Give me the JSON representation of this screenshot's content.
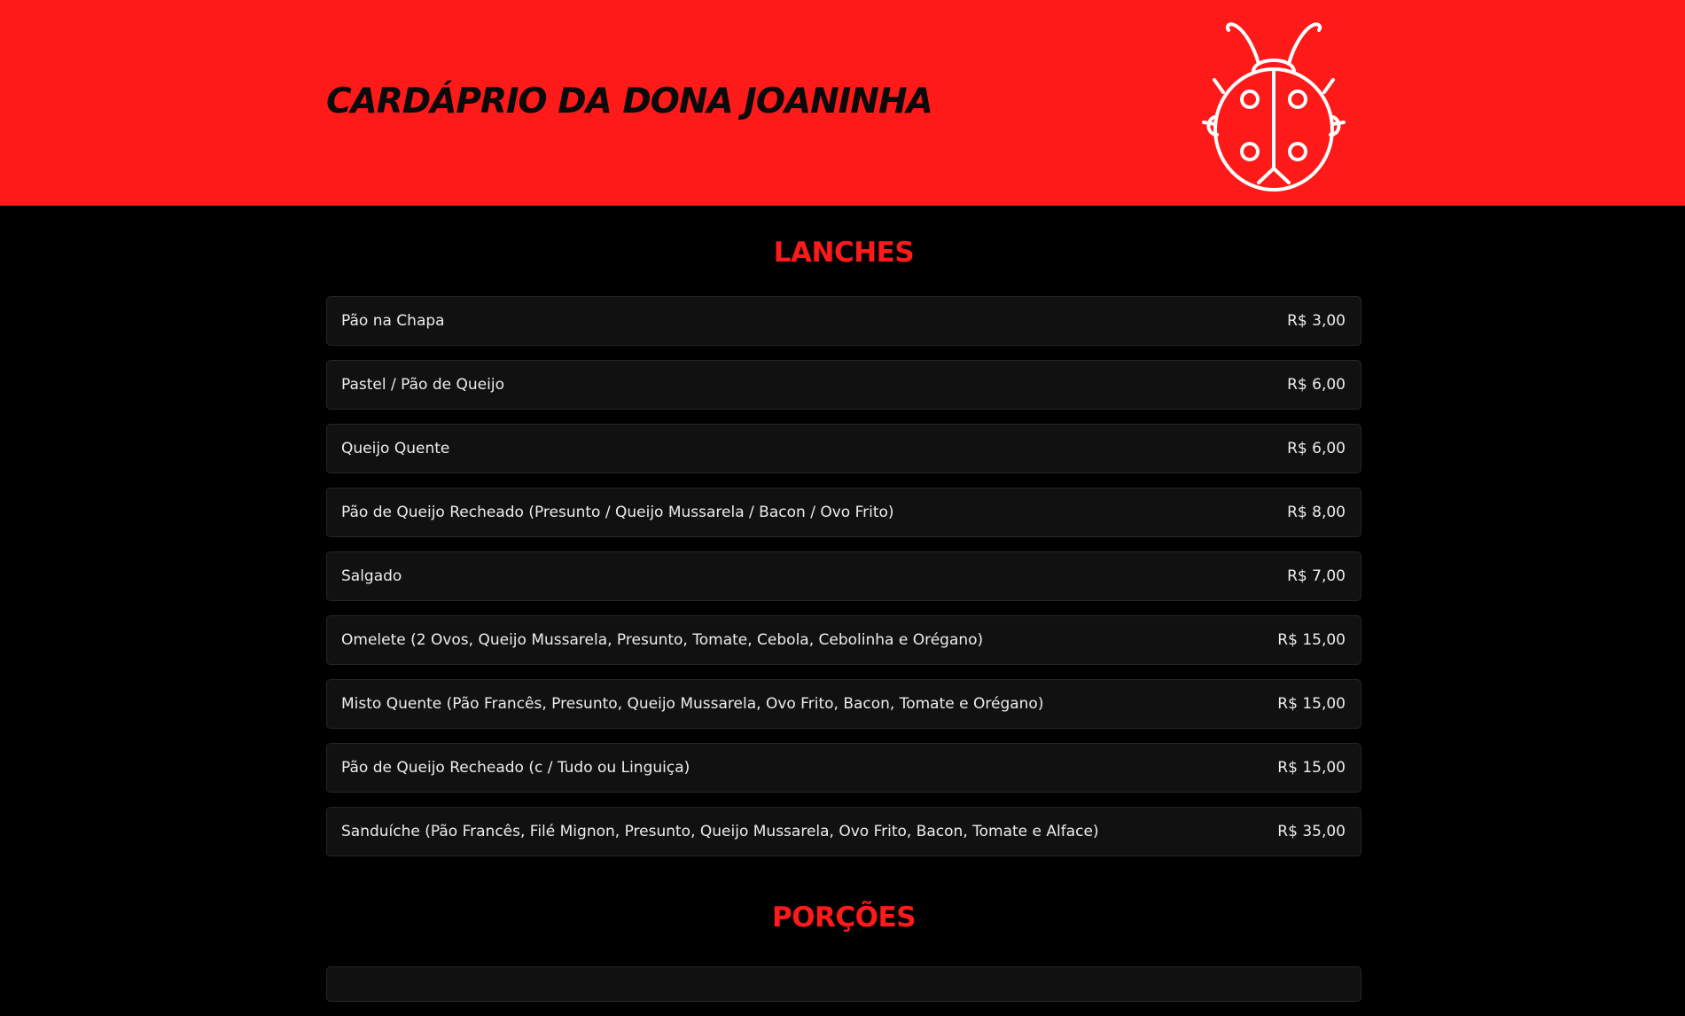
{
  "header": {
    "title": "CARDÁPRIO DA DONA JOANINHA",
    "logo_icon": "ladybug-icon",
    "background_color": "#ff1a1a"
  },
  "colors": {
    "accent": "#ff1a1a",
    "page_background": "#000000",
    "card_background": "#111111",
    "card_border": "#262626",
    "text": "#ececec"
  },
  "sections": [
    {
      "title": "LANCHES",
      "items": [
        {
          "name": "Pão na Chapa",
          "price": "R$ 3,00"
        },
        {
          "name": "Pastel / Pão de Queijo",
          "price": "R$ 6,00"
        },
        {
          "name": "Queijo Quente",
          "price": "R$ 6,00"
        },
        {
          "name": "Pão de Queijo Recheado (Presunto / Queijo Mussarela / Bacon / Ovo Frito)",
          "price": "R$ 8,00"
        },
        {
          "name": "Salgado",
          "price": "R$ 7,00"
        },
        {
          "name": "Omelete (2 Ovos, Queijo Mussarela, Presunto, Tomate, Cebola, Cebolinha e Orégano)",
          "price": "R$ 15,00"
        },
        {
          "name": "Misto Quente (Pão Francês, Presunto, Queijo Mussarela, Ovo Frito, Bacon, Tomate e Orégano)",
          "price": "R$ 15,00"
        },
        {
          "name": "Pão de Queijo Recheado (c / Tudo ou Linguiça)",
          "price": "R$ 15,00"
        },
        {
          "name": "Sanduíche (Pão Francês, Filé Mignon, Presunto, Queijo Mussarela, Ovo Frito, Bacon, Tomate e Alface)",
          "price": "R$ 35,00"
        }
      ]
    },
    {
      "title": "PORÇÕES",
      "items": []
    }
  ]
}
